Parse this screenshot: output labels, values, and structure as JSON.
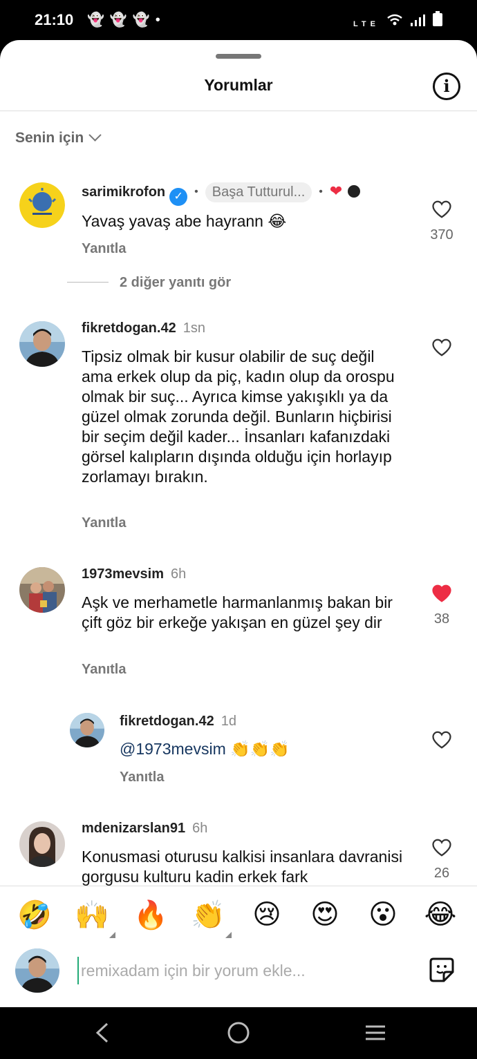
{
  "status_bar": {
    "time": "21:10",
    "left_icons": [
      "snapchat-icon",
      "snapchat-icon",
      "snapchat-icon",
      "dot-icon"
    ],
    "right_icons": [
      "volte-icon",
      "wifi-icon",
      "signal-icon",
      "battery-icon"
    ]
  },
  "sheet": {
    "title": "Yorumlar",
    "sort_label": "Senin için"
  },
  "comments": [
    {
      "username": "sarimikrofon",
      "verified": true,
      "pinned_label": "Başa Tutturul...",
      "text": "Yavaş yavaş abe hayrann 😂",
      "reply_label": "Yanıtla",
      "likes": "370",
      "liked": false,
      "creator_reaction": "❤️"
    },
    {
      "username": "fikretdogan.42",
      "time": "1sn",
      "text": "Tipsiz olmak bir kusur olabilir de suç değil ama erkek olup da piç, kadın olup da orospu olmak bir suç... Ayrıca kimse yakışıklı ya da güzel olmak zorunda değil. Bunların hiçbirisi bir seçim değil kader... İnsanları kafanızdaki görsel kalıpların dışında olduğu için horlayıp zorlamayı bırakın.",
      "reply_label": "Yanıtla",
      "likes": "",
      "liked": false
    },
    {
      "username": "1973mevsim",
      "time": "6h",
      "text": "Aşk ve merhametle harmanlanmış  bakan bir çift göz  bir erkeğe yakışan en güzel şey dir",
      "reply_label": "Yanıtla",
      "likes": "38",
      "liked": true
    },
    {
      "username": "fikretdogan.42",
      "time": "1d",
      "mention": "@1973mevsim",
      "text": "👏👏👏",
      "reply_label": "Yanıtla",
      "likes": "",
      "liked": false
    },
    {
      "username": "mdenizarslan91",
      "time": "6h",
      "text": "Konusmasi oturusu kalkisi insanlara davranisi gorgusu kulturu kadin erkek fark",
      "likes": "26",
      "liked": false
    }
  ],
  "view_replies": "2 diğer yanıtı gör",
  "quick_emojis": [
    "🤣",
    "🙌",
    "🔥",
    "👏",
    "😢",
    "😍",
    "😮",
    "😂"
  ],
  "input": {
    "placeholder": "remixadam için bir yorum ekle..."
  },
  "colors": {
    "like_red": "#ed2d44",
    "verified_blue": "#1e90f5",
    "mention_blue": "#16365f"
  },
  "nav_icons": [
    "back-icon",
    "home-icon",
    "recents-icon"
  ]
}
